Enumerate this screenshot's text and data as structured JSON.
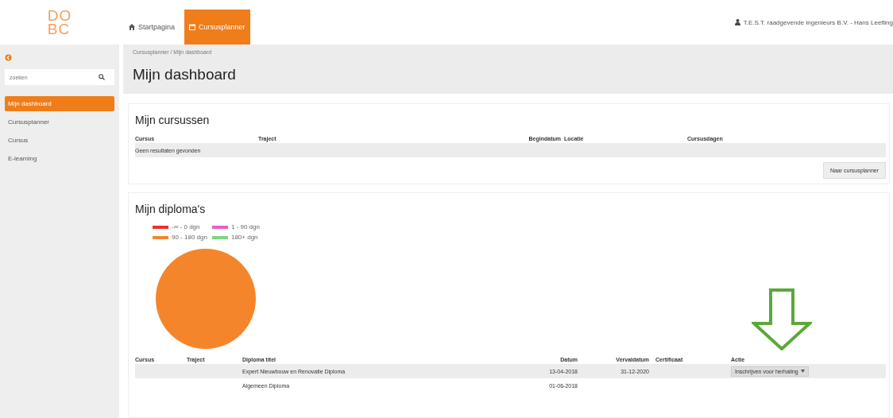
{
  "logo": {
    "text_top": "DO",
    "text_bottom": "BC"
  },
  "nav": [
    {
      "label": "Startpagina",
      "selected": false
    },
    {
      "label": "Cursusplanner",
      "selected": true
    }
  ],
  "user": {
    "label": "T.E.S.T. raadgevende ingenieurs B.V. - Hans Leefling"
  },
  "sidebar": {
    "search": {
      "placeholder": "zoeken"
    },
    "items": [
      {
        "label": "Mijn dashboard",
        "selected": true
      },
      {
        "label": "Cursusplanner",
        "selected": false
      },
      {
        "label": "Cursus",
        "selected": false
      },
      {
        "label": "E-learning",
        "selected": false
      }
    ]
  },
  "breadcrumb": "Cursusplanner / Mijn dashboard",
  "page_title": "Mijn dashboard",
  "courses": {
    "title": "Mijn cursussen",
    "columns": [
      "Cursus",
      "Traject",
      "Begindatum",
      "Locatie",
      "Cursusdagen"
    ],
    "empty": "Geen resultaten gevonden",
    "button": "Naar cursusplanner"
  },
  "diplomas": {
    "title": "Mijn diploma's",
    "chart_data": {
      "type": "pie",
      "categories": [
        "-∞ - 0 dgn",
        "1 - 90 dgn",
        "90 - 180 dgn",
        "180+ dgn"
      ],
      "values": [
        0,
        0,
        100,
        0
      ],
      "colors": [
        "#e8322c",
        "#e55fc8",
        "#f5852b",
        "#7fd67a"
      ]
    },
    "columns": [
      "Cursus",
      "Traject",
      "Diploma titel",
      "Datum",
      "Vervaldatum",
      "Certificaat",
      "Actie"
    ],
    "rows": [
      {
        "cells": [
          "",
          "",
          "Expert Nieuwbouw en Renovatie Diploma",
          "13-04-2018",
          "31-12-2020",
          ""
        ],
        "action": "Inschrijven voor herhaling"
      },
      {
        "cells": [
          "",
          "",
          "Algemeen Diploma",
          "01-06-2018",
          "",
          ""
        ],
        "action": ""
      }
    ]
  }
}
